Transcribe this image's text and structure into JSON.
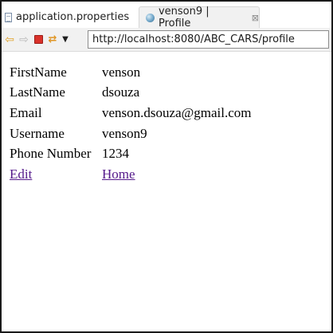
{
  "tabs": [
    {
      "label": "application.properties",
      "icon": "document-icon",
      "active": false
    },
    {
      "label": "venson9 | Profile",
      "icon": "globe-icon",
      "active": true,
      "close_glyph": "⊠"
    }
  ],
  "toolbar": {
    "back_icon": "back-arrow-icon",
    "forward_icon": "forward-arrow-icon",
    "stop_icon": "stop-icon",
    "refresh_icon": "refresh-icon",
    "dropdown_icon": "dropdown-arrow-icon",
    "url": "http://localhost:8080/ABC_CARS/profile"
  },
  "profile": {
    "rows": [
      {
        "label": "FirstName",
        "value": "venson"
      },
      {
        "label": "LastName",
        "value": "dsouza"
      },
      {
        "label": "Email",
        "value": "venson.dsouza@gmail.com"
      },
      {
        "label": "Username",
        "value": "venson9"
      },
      {
        "label": "Phone Number",
        "value": "1234"
      }
    ],
    "edit_link": "Edit",
    "home_link": "Home"
  },
  "colors": {
    "link_visited": "#551a8b",
    "stop_red": "#d9312a",
    "nav_orange": "#e0a126"
  }
}
